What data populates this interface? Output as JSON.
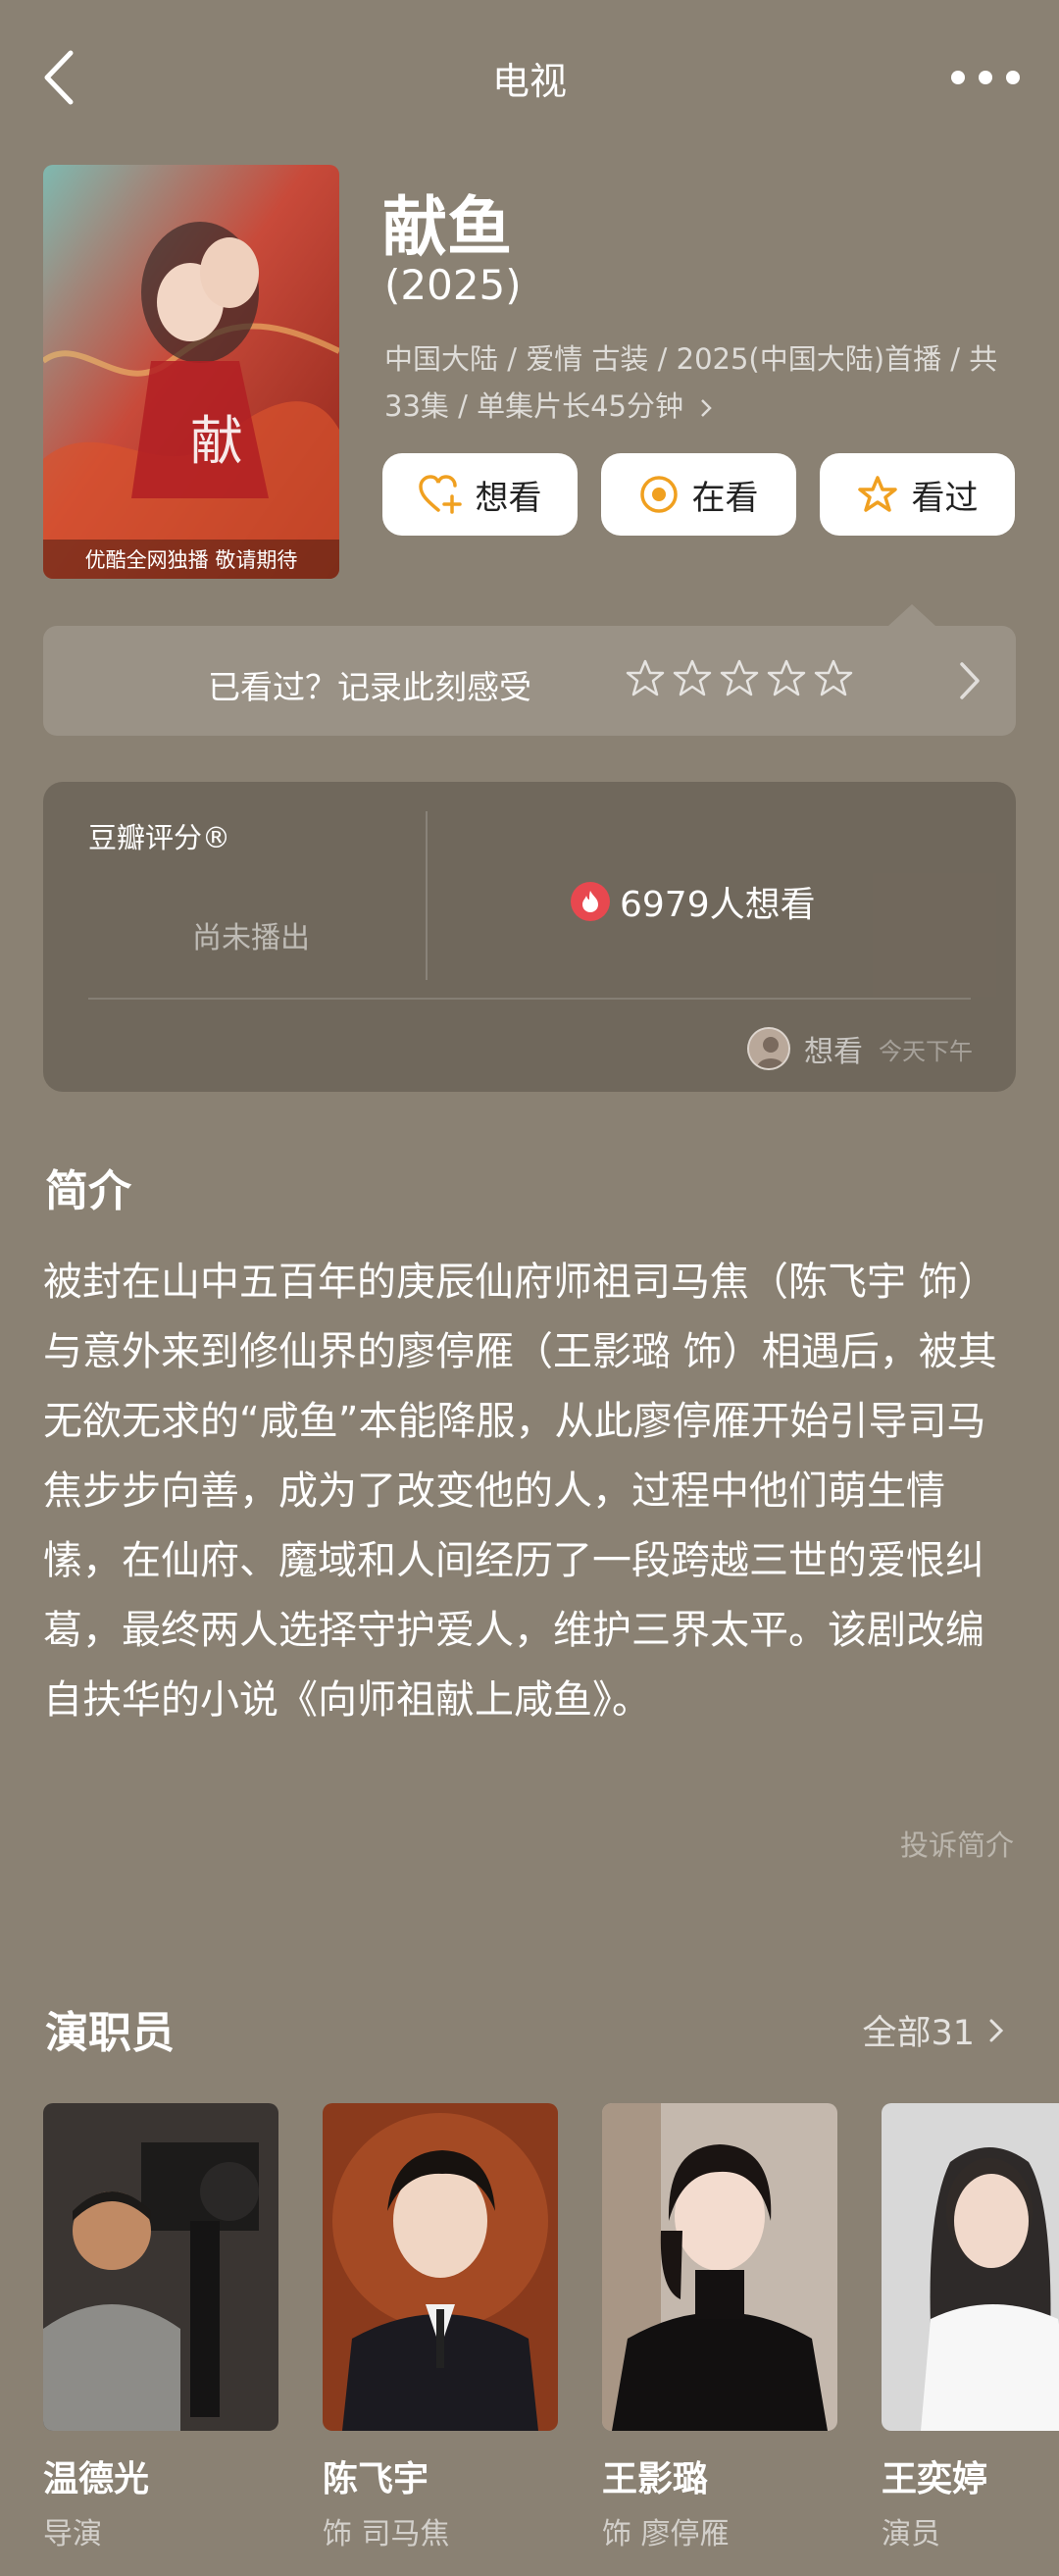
{
  "nav": {
    "title": "电视",
    "back_icon": "chevron-left-icon",
    "more_icon": "ellipsis-icon"
  },
  "show": {
    "title": "献鱼",
    "year": "(2025)",
    "meta": "中国大陆 / 爱情 古装 / 2025(中国大陆)首播 / 共33集 / 单集片长45分钟",
    "poster_caption": "优酷全网独播 敬请期待"
  },
  "actions": {
    "want": "想看",
    "watching": "在看",
    "watched": "看过"
  },
  "rating_prompt": {
    "text": "已看过？记录此刻感受",
    "stars_total": 5
  },
  "score": {
    "label": "豆瓣评分®",
    "status": "尚未播出",
    "want_count": "6979人想看",
    "activity_action": "想看",
    "activity_time": "今天下午"
  },
  "intro": {
    "title": "简介",
    "text": "被封在山中五百年的庚辰仙府师祖司马焦（陈飞宇 饰）与意外来到修仙界的廖停雁（王影璐 饰）相遇后，被其无欲无求的“咸鱼”本能降服，从此廖停雁开始引导司马焦步步向善，成为了改变他的人，过程中他们萌生情愫，在仙府、魔域和人间经历了一段跨越三世的爱恨纠葛，最终两人选择守护爱人，维护三界太平。该剧改编自扶华的小说《向师祖献上咸鱼》。",
    "report": "投诉简介"
  },
  "cast": {
    "title": "演职员",
    "all_label": "全部31",
    "members": [
      {
        "name": "温德光",
        "role": "导演"
      },
      {
        "name": "陈飞宇",
        "role": "饰 司马焦"
      },
      {
        "name": "王影璐",
        "role": "饰 廖停雁"
      },
      {
        "name": "王奕婷",
        "role": "演员"
      }
    ]
  },
  "colors": {
    "background": "#8a8173",
    "accent_orange": "#f0a020",
    "fire_red": "#e8484f"
  }
}
